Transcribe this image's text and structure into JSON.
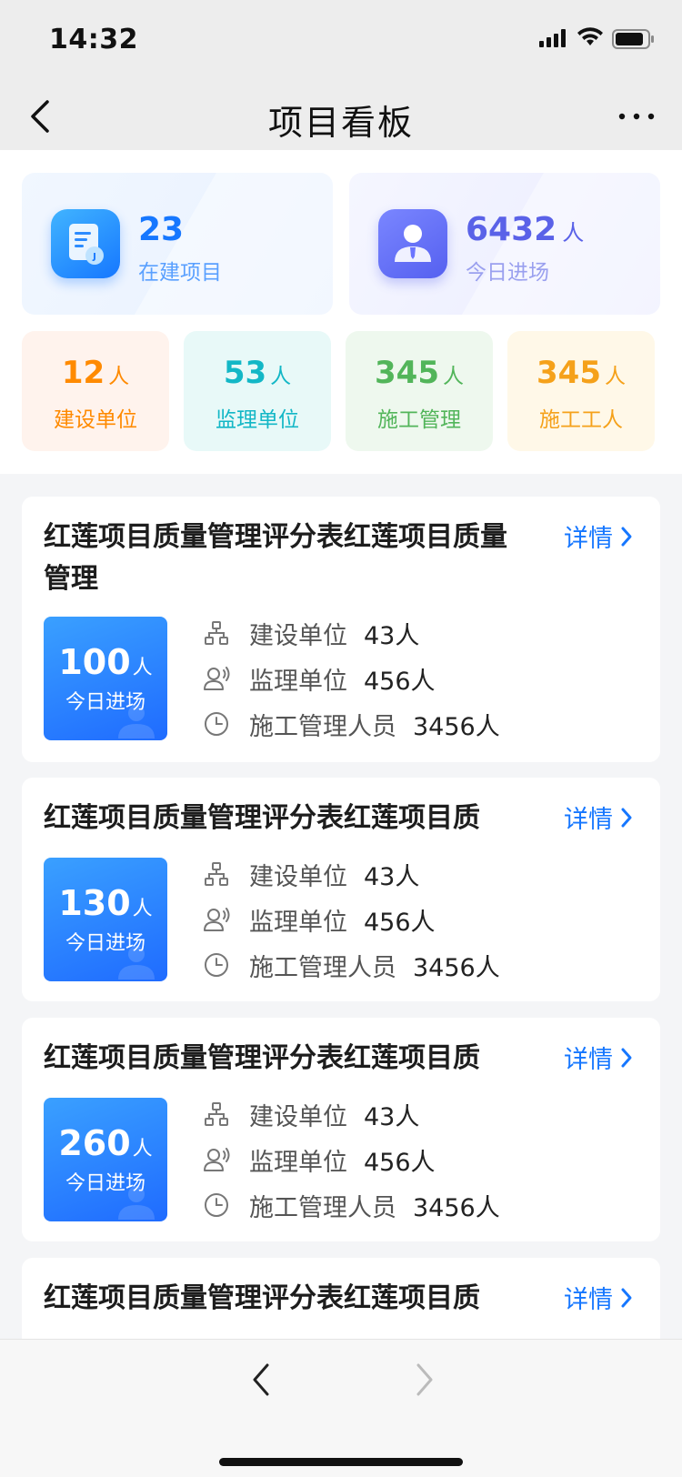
{
  "status": {
    "time": "14:32"
  },
  "nav": {
    "title": "项目看板"
  },
  "summary": {
    "projects": {
      "value": "23",
      "label": "在建项目"
    },
    "entries": {
      "value": "6432",
      "unit": "人",
      "label": "今日进场"
    },
    "stats": [
      {
        "value": "12",
        "unit": "人",
        "label": "建设单位",
        "color": "#ff8a00",
        "bg": "#fff3ed"
      },
      {
        "value": "53",
        "unit": "人",
        "label": "监理单位",
        "color": "#13b7c6",
        "bg": "#e8f9f8"
      },
      {
        "value": "345",
        "unit": "人",
        "label": "施工管理",
        "color": "#52b55a",
        "bg": "#eef8ee"
      },
      {
        "value": "345",
        "unit": "人",
        "label": "施工工人",
        "color": "#f5a11a",
        "bg": "#fff8e8"
      }
    ]
  },
  "projects": [
    {
      "title": "红莲项目质量管理评分表红莲项目质量管理",
      "detail": "详情",
      "today": {
        "value": "100",
        "unit": "人",
        "label": "今日进场"
      },
      "rows": [
        {
          "icon": "org-chart-icon",
          "label": "建设单位",
          "value": "43人"
        },
        {
          "icon": "supervisor-icon",
          "label": "监理单位",
          "value": "456人"
        },
        {
          "icon": "clock-icon",
          "label": "施工管理人员",
          "value": "3456人"
        }
      ]
    },
    {
      "title": "红莲项目质量管理评分表红莲项目质",
      "detail": "详情",
      "today": {
        "value": "130",
        "unit": "人",
        "label": "今日进场"
      },
      "rows": [
        {
          "icon": "org-chart-icon",
          "label": "建设单位",
          "value": "43人"
        },
        {
          "icon": "supervisor-icon",
          "label": "监理单位",
          "value": "456人"
        },
        {
          "icon": "clock-icon",
          "label": "施工管理人员",
          "value": "3456人"
        }
      ]
    },
    {
      "title": "红莲项目质量管理评分表红莲项目质",
      "detail": "详情",
      "today": {
        "value": "260",
        "unit": "人",
        "label": "今日进场"
      },
      "rows": [
        {
          "icon": "org-chart-icon",
          "label": "建设单位",
          "value": "43人"
        },
        {
          "icon": "supervisor-icon",
          "label": "监理单位",
          "value": "456人"
        },
        {
          "icon": "clock-icon",
          "label": "施工管理人员",
          "value": "3456人"
        }
      ]
    },
    {
      "title": "红莲项目质量管理评分表红莲项目质",
      "detail": "详情"
    }
  ]
}
